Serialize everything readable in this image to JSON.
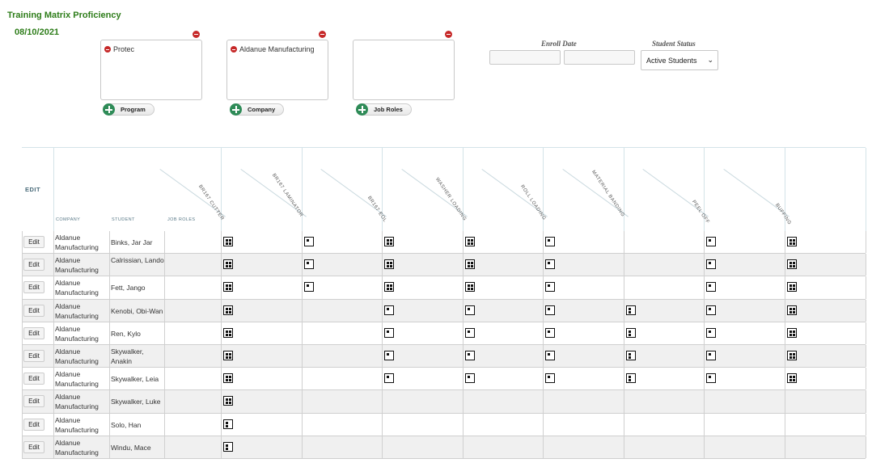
{
  "header": {
    "title": "Training Matrix Proficiency",
    "date": "08/10/2021"
  },
  "filters": [
    {
      "chips": [
        "Protec"
      ],
      "add_label": "Program"
    },
    {
      "chips": [
        "Aldanue Manufacturing"
      ],
      "add_label": "Company"
    },
    {
      "chips": [],
      "add_label": "Job Roles"
    }
  ],
  "enroll_date": {
    "label": "Enroll Date",
    "from_value": "",
    "to_value": ""
  },
  "student_status": {
    "label": "Student Status",
    "selected": "Active Students"
  },
  "grid": {
    "edit_heading": "EDIT",
    "company_heading": "COMPANY",
    "student_heading": "STUDENT",
    "jobroles_heading": "JOB ROLES",
    "programs": [
      "BR167 Cutter",
      "BR167 Laminator",
      "BR167 EOL",
      "Washer Loading",
      "Roll Loading",
      "Material Banding",
      "Peel Off",
      "Buffing"
    ],
    "edit_label": "Edit",
    "rows": [
      {
        "company": "Aldanue Manufacturing",
        "student": "Binks, Jar Jar",
        "marks": [
          "full",
          "tl",
          "full",
          "full",
          "tl",
          "",
          "tl",
          "full"
        ]
      },
      {
        "company": "Aldanue Manufacturing",
        "student": "Calrissian, Lando",
        "marks": [
          "full",
          "tl",
          "full",
          "full",
          "tl",
          "",
          "tl",
          "full"
        ]
      },
      {
        "company": "Aldanue Manufacturing",
        "student": "Fett, Jango",
        "marks": [
          "full",
          "tl",
          "full",
          "full",
          "tl",
          "",
          "tl",
          "full"
        ]
      },
      {
        "company": "Aldanue Manufacturing",
        "student": "Kenobi, Obi-Wan",
        "marks": [
          "full",
          "",
          "tl",
          "tl",
          "tl",
          "tlbl",
          "tl",
          "full"
        ]
      },
      {
        "company": "Aldanue Manufacturing",
        "student": "Ren, Kylo",
        "marks": [
          "full",
          "",
          "tl",
          "tl",
          "tl",
          "tlbl",
          "tl",
          "full"
        ]
      },
      {
        "company": "Aldanue Manufacturing",
        "student": "Skywalker, Anakin",
        "marks": [
          "full",
          "",
          "tl",
          "tl",
          "tl",
          "tlbl",
          "tl",
          "full"
        ]
      },
      {
        "company": "Aldanue Manufacturing",
        "student": "Skywalker, Leia",
        "marks": [
          "full",
          "",
          "tl",
          "tl",
          "tl",
          "tlbl",
          "tl",
          "full"
        ]
      },
      {
        "company": "Aldanue Manufacturing",
        "student": "Skywalker, Luke",
        "marks": [
          "full",
          "",
          "",
          "",
          "",
          "",
          "",
          ""
        ]
      },
      {
        "company": "Aldanue Manufacturing",
        "student": "Solo, Han",
        "marks": [
          "tlbl",
          "",
          "",
          "",
          "",
          "",
          "",
          ""
        ]
      },
      {
        "company": "Aldanue Manufacturing",
        "student": "Windu, Mace",
        "marks": [
          "tlbl",
          "",
          "",
          "",
          "",
          "",
          "",
          ""
        ]
      }
    ]
  }
}
